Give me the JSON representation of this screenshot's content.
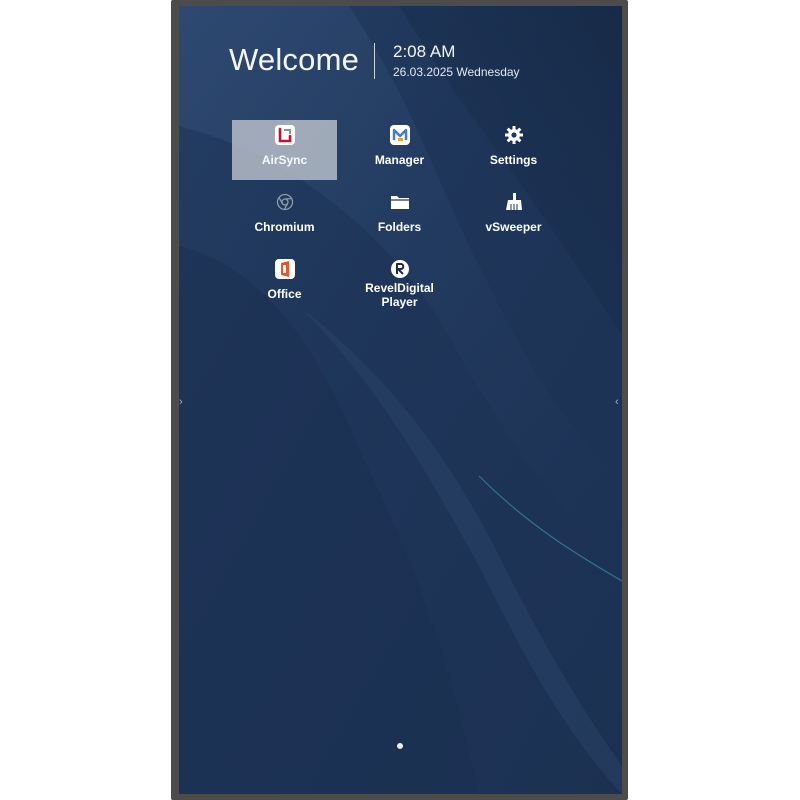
{
  "header": {
    "welcome": "Welcome",
    "time": "2:08 AM",
    "date": "26.03.2025 Wednesday"
  },
  "apps": [
    {
      "label": "AirSync",
      "icon": "airsync-icon",
      "selected": true
    },
    {
      "label": "Manager",
      "icon": "manager-icon",
      "selected": false
    },
    {
      "label": "Settings",
      "icon": "gear-icon",
      "selected": false
    },
    {
      "label": "Chromium",
      "icon": "chromium-icon",
      "selected": false
    },
    {
      "label": "Folders",
      "icon": "folder-icon",
      "selected": false
    },
    {
      "label": "vSweeper",
      "icon": "broom-icon",
      "selected": false
    },
    {
      "label": "Office",
      "icon": "office-icon",
      "selected": false
    },
    {
      "label": "RevelDigital\nPlayer",
      "icon": "reveldigital-icon",
      "selected": false
    }
  ],
  "pager": {
    "current_page": 1,
    "total_pages": 1
  },
  "colors": {
    "screen_background": "#1f3557",
    "bezel": "#4d4b4c",
    "selection_highlight": "#ced2da",
    "text": "#ffffff"
  }
}
